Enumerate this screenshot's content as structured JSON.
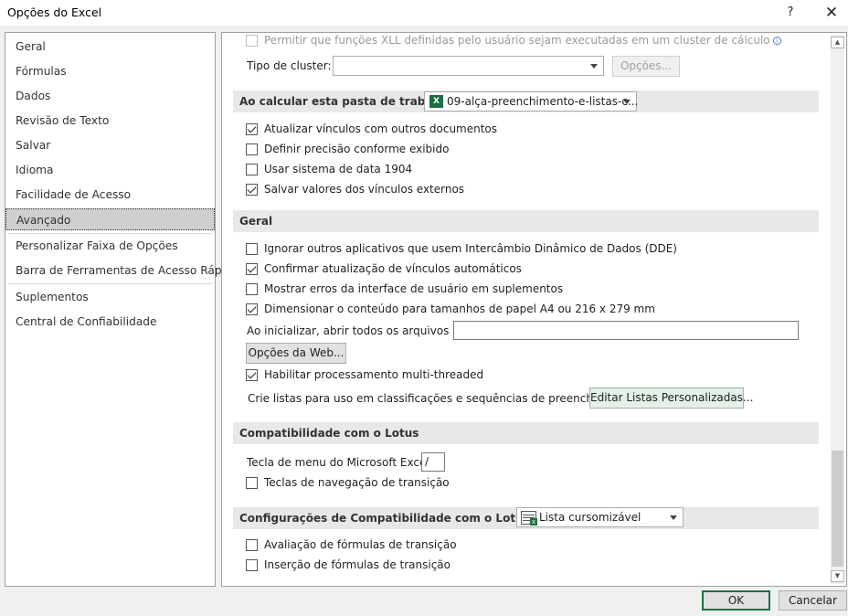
{
  "window": {
    "title": "Opções do Excel",
    "help_label": "?",
    "close_label": "✕"
  },
  "nav": {
    "items": [
      {
        "label": "Geral"
      },
      {
        "label": "Fórmulas"
      },
      {
        "label": "Dados"
      },
      {
        "label": "Revisão de Texto"
      },
      {
        "label": "Salvar"
      },
      {
        "label": "Idioma"
      },
      {
        "label": "Facilidade de Acesso"
      },
      {
        "label": "Avançado",
        "selected": true
      },
      {
        "label": "Personalizar Faixa de Opções"
      },
      {
        "label": "Barra de Ferramentas de Acesso Rápido"
      },
      {
        "label": "Suplementos"
      },
      {
        "label": "Central de Confiabilidade"
      }
    ]
  },
  "top": {
    "xll_label": "Permitir que funções XLL definidas pelo usuário sejam executadas em um cluster de cálculo",
    "xll_checked": false,
    "cluster_type_label": "Tipo de cluster:",
    "cluster_type_value": "",
    "cluster_options_button": "Opções..."
  },
  "calc_workbook": {
    "header": "Ao calcular esta pasta de trabalho:",
    "workbook_value": "09-alça-preenchimento-e-listas-c...",
    "options": [
      {
        "label": "Atualizar vínculos com outros documentos",
        "checked": true
      },
      {
        "label": "Definir precisão conforme exibido",
        "checked": false
      },
      {
        "label": "Usar sistema de data 1904",
        "checked": false
      },
      {
        "label": "Salvar valores dos vínculos externos",
        "checked": true
      }
    ]
  },
  "general": {
    "header": "Geral",
    "options": [
      {
        "label": "Ignorar outros aplicativos que usem Intercâmbio Dinâmico de Dados (DDE)",
        "checked": false
      },
      {
        "label": "Confirmar atualização de vínculos automáticos",
        "checked": true
      },
      {
        "label": "Mostrar erros da interface de usuário em suplementos",
        "checked": false
      },
      {
        "label": "Dimensionar o conteúdo para tamanhos de papel A4 ou 216 x 279 mm",
        "checked": true
      }
    ],
    "startup_label": "Ao inicializar, abrir todos os arquivos em:",
    "startup_value": "",
    "web_options_button": "Opções da Web...",
    "multithread_label": "Habilitar processamento multi-threaded",
    "multithread_checked": true,
    "custom_lists_label": "Crie listas para uso em classificações e sequências de preenchimento:",
    "custom_lists_button": "Editar Listas Personalizadas..."
  },
  "lotus": {
    "header": "Compatibilidade com o Lotus",
    "menu_key_label": "Tecla de menu do Microsoft Excel:",
    "menu_key_value": "/",
    "nav_keys_label": "Teclas de navegação de transição",
    "nav_keys_checked": false
  },
  "lotus_settings": {
    "header": "Configurações de Compatibilidade com o Lotus para:",
    "sheet_value": "Lista cursomizável",
    "options": [
      {
        "label": "Avaliação de fórmulas de transição",
        "checked": false
      },
      {
        "label": "Inserção de fórmulas de transição",
        "checked": false
      }
    ]
  },
  "footer": {
    "ok_label": "OK",
    "cancel_label": "Cancelar"
  },
  "colors": {
    "excel_green": "#1d6f42",
    "selected_nav": "#cfcfcf",
    "section_header": "#e8e8e8"
  }
}
